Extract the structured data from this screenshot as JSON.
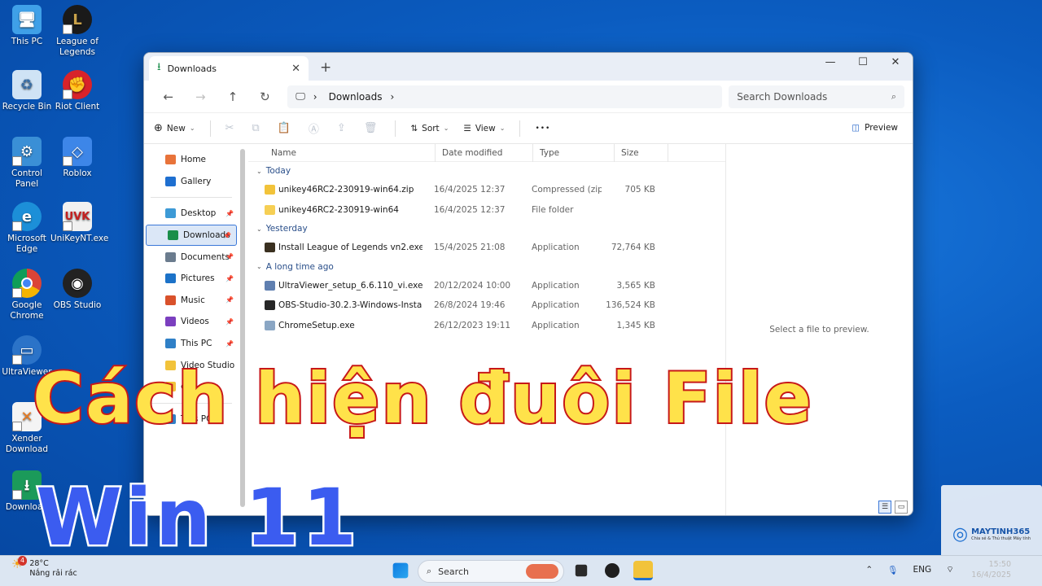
{
  "desktop_icons": [
    {
      "label": "This PC"
    },
    {
      "label": "League of Legends"
    },
    {
      "label": "Recycle Bin"
    },
    {
      "label": "Riot Client"
    },
    {
      "label": "Control Panel"
    },
    {
      "label": "Roblox"
    },
    {
      "label": "Microsoft Edge"
    },
    {
      "label": "UniKeyNT.exe"
    },
    {
      "label": "Google Chrome"
    },
    {
      "label": "OBS Studio"
    },
    {
      "label": "UltraViewer"
    },
    {
      "label": "Xender Download"
    },
    {
      "label": "Download"
    }
  ],
  "window": {
    "tab_title": "Downloads",
    "tab_close": "✕",
    "new_tab": "+",
    "minimize": "—",
    "maximize": "☐",
    "close": "✕"
  },
  "navbar": {
    "back": "←",
    "forward": "→",
    "up": "↑",
    "refresh": "↻",
    "path_sep": "›",
    "path": "Downloads",
    "path_end": "›",
    "search_placeholder": "Search Downloads"
  },
  "cmdbar": {
    "new": "New",
    "sort": "Sort",
    "view": "View",
    "more": "•••",
    "preview": "Preview"
  },
  "sidebar": [
    {
      "label": "Home",
      "color": "#e8733a"
    },
    {
      "label": "Gallery",
      "color": "#1e6fd0"
    },
    {
      "label": "Desktop",
      "color": "#3d9ad6",
      "pinned": true
    },
    {
      "label": "Downloads",
      "color": "#1b8e4b",
      "pinned": true,
      "selected": true
    },
    {
      "label": "Documents",
      "color": "#6b7c8e",
      "pinned": true
    },
    {
      "label": "Pictures",
      "color": "#1c72c8",
      "pinned": true
    },
    {
      "label": "Music",
      "color": "#d9512b",
      "pinned": true
    },
    {
      "label": "Videos",
      "color": "#7b3fbf",
      "pinned": true
    },
    {
      "label": "This PC",
      "color": "#2f80c7",
      "pinned": true
    },
    {
      "label": "Video Studio",
      "color": "#f2c33a"
    },
    {
      "label": "etc",
      "color": "#f2c33a"
    },
    {
      "label": "This PC",
      "color": "#2f80c7"
    }
  ],
  "columns": [
    "Name",
    "Date modified",
    "Type",
    "Size"
  ],
  "groups": [
    {
      "title": "Today",
      "files": [
        {
          "name": "unikey46RC2-230919-win64.zip",
          "date": "16/4/2025 12:37",
          "type": "Compressed (zipp...",
          "size": "705 KB",
          "icon_color": "#f2c33a"
        },
        {
          "name": "unikey46RC2-230919-win64",
          "date": "16/4/2025 12:37",
          "type": "File folder",
          "size": "",
          "icon_color": "#f6cf54"
        }
      ]
    },
    {
      "title": "Yesterday",
      "files": [
        {
          "name": "Install League of Legends vn2.exe",
          "date": "15/4/2025 21:08",
          "type": "Application",
          "size": "72,764 KB",
          "icon_color": "#3a3020"
        }
      ]
    },
    {
      "title": "A long time ago",
      "files": [
        {
          "name": "UltraViewer_setup_6.6.110_vi.exe",
          "date": "20/12/2024 10:00",
          "type": "Application",
          "size": "3,565 KB",
          "icon_color": "#5f7fb0"
        },
        {
          "name": "OBS-Studio-30.2.3-Windows-Installer.exe",
          "date": "26/8/2024 19:46",
          "type": "Application",
          "size": "136,524 KB",
          "icon_color": "#262626"
        },
        {
          "name": "ChromeSetup.exe",
          "date": "26/12/2023 19:11",
          "type": "Application",
          "size": "1,345 KB",
          "icon_color": "#8aa6c4"
        }
      ]
    }
  ],
  "preview_message": "Select a file to preview.",
  "overlay": {
    "line1": "Cách hiện đuôi File",
    "line2": "Win 11"
  },
  "taskbar": {
    "weather_temp": "28°C",
    "weather_desc": "Nắng rải rác",
    "weather_badge": "4",
    "search_label": "Search",
    "lang": "ENG",
    "time": "15:50",
    "date": "16/4/2025"
  },
  "watermark": {
    "brand": "MAYTINH365",
    "tagline": "Chia sẻ & Thủ thuật Máy tính"
  }
}
